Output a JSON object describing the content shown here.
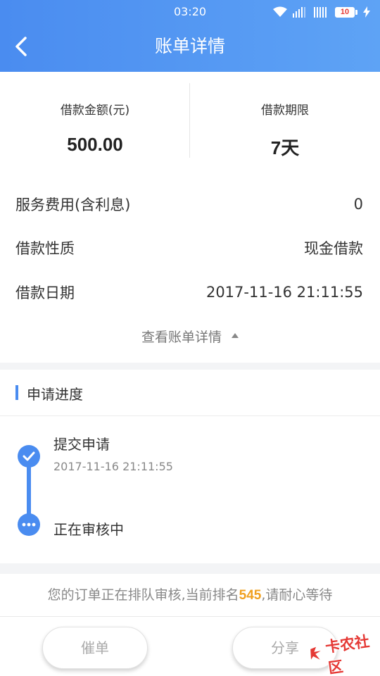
{
  "status_bar": {
    "time": "03:20",
    "battery_level": "10"
  },
  "header": {
    "title": "账单详情"
  },
  "summary": {
    "amount_label": "借款金额(元)",
    "amount_value": "500.00",
    "term_label": "借款期限",
    "term_value": "7天"
  },
  "details": [
    {
      "label": "服务费用(含利息)",
      "value": "0"
    },
    {
      "label": "借款性质",
      "value": "现金借款"
    },
    {
      "label": "借款日期",
      "value": "2017-11-16 21:11:55"
    }
  ],
  "toggle_label": "查看账单详情",
  "progress": {
    "title": "申请进度",
    "steps": [
      {
        "title": "提交申请",
        "time": "2017-11-16 21:11:55",
        "status": "done"
      },
      {
        "title": "正在审核中",
        "status": "in-progress"
      }
    ]
  },
  "queue": {
    "prefix": "您的订单正在排队审核,当前排名",
    "rank": "545",
    "suffix": ",请耐心等待"
  },
  "actions": {
    "urge_label": "催单",
    "share_label": "分享"
  },
  "watermark": {
    "text": "卡农社区"
  },
  "colors": {
    "accent": "#4a8cf0",
    "rank": "#f0a020",
    "watermark": "#e53935"
  }
}
